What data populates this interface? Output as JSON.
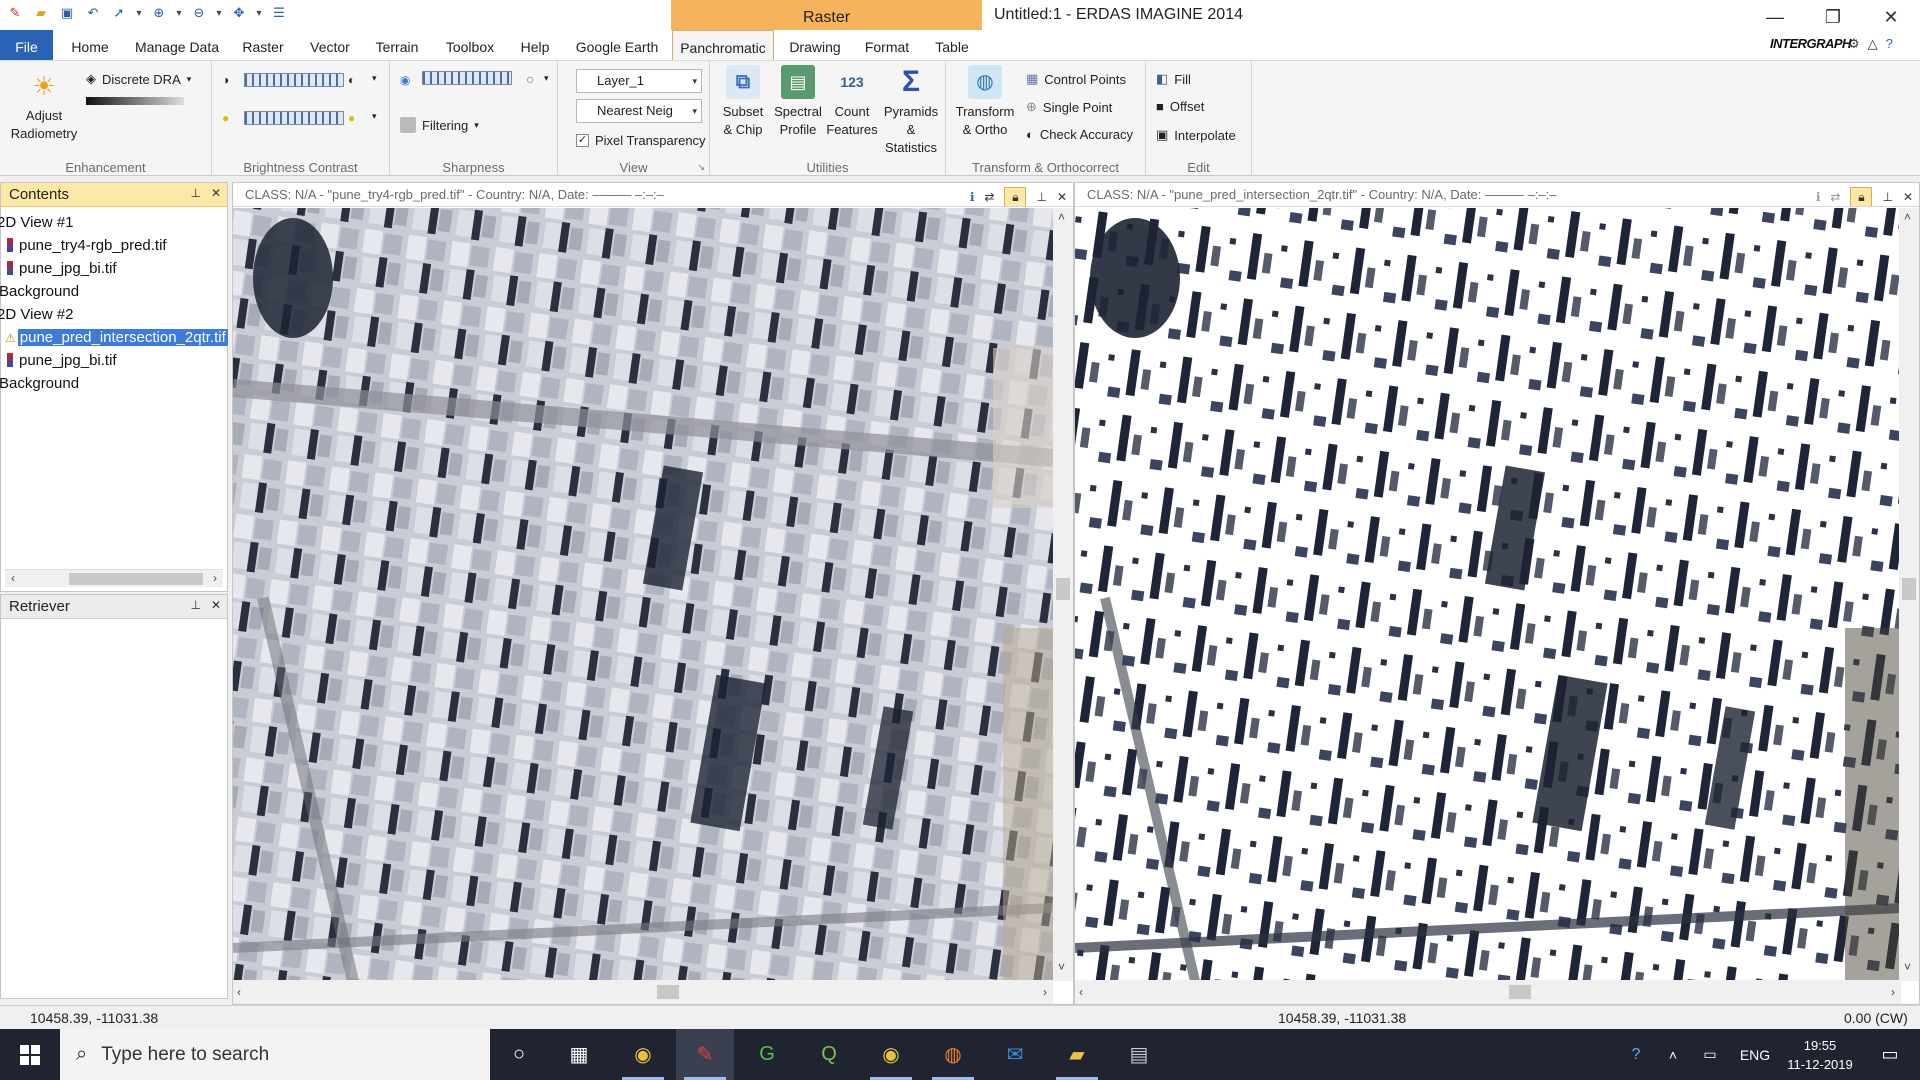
{
  "title_bar": {
    "window_title": "Untitled:1 - ERDAS IMAGINE 2014",
    "context_tab_group": "Raster",
    "controls": {
      "minimize": "—",
      "restore": "❐",
      "close": "✕"
    }
  },
  "ribbon_tabs": [
    "File",
    "Home",
    "Manage Data",
    "Raster",
    "Vector",
    "Terrain",
    "Toolbox",
    "Help",
    "Google Earth",
    "Panchromatic",
    "Drawing",
    "Format",
    "Table"
  ],
  "brand": "INTERGRAPH",
  "ribbon": {
    "enhancement": {
      "label": "Enhancement",
      "adjust_radiometry": "Adjust\nRadiometry",
      "discrete_dra": "Discrete DRA"
    },
    "brightness_contrast": {
      "label": "Brightness Contrast"
    },
    "sharpness": {
      "label": "Sharpness",
      "filtering": "Filtering"
    },
    "view": {
      "label": "View",
      "layer_combo": "Layer_1",
      "resample_combo": "Nearest Neig",
      "pixel_transparency": "Pixel Transparency"
    },
    "utilities": {
      "label": "Utilities",
      "subset_chip": "Subset\n& Chip",
      "spectral_profile": "Spectral\nProfile",
      "count_features": "Count\nFeatures",
      "pyramids_statistics": "Pyramids &\nStatistics"
    },
    "transform": {
      "label": "Transform & Orthocorrect",
      "transform_ortho": "Transform\n& Ortho",
      "control_points": "Control Points",
      "single_point": "Single Point",
      "check_accuracy": "Check Accuracy"
    },
    "edit": {
      "label": "Edit",
      "fill": "Fill",
      "offset": "Offset",
      "interpolate": "Interpolate"
    }
  },
  "contents_panel": {
    "title": "Contents",
    "items": [
      {
        "label": "2D View #1",
        "type": "view"
      },
      {
        "label": "pune_try4-rgb_pred.tif",
        "type": "layer"
      },
      {
        "label": "pune_jpg_bi.tif",
        "type": "layer"
      },
      {
        "label": "Background",
        "type": "bg"
      },
      {
        "label": "2D View #2",
        "type": "view"
      },
      {
        "label": "pune_pred_intersection_2qtr.tif",
        "type": "layer",
        "selected": true
      },
      {
        "label": "pune_jpg_bi.tif",
        "type": "layer"
      },
      {
        "label": "Background",
        "type": "bg"
      }
    ]
  },
  "retriever_panel": {
    "title": "Retriever"
  },
  "view1": {
    "header": "CLASS: N/A - \"pune_try4-rgb_pred.tif\" - Country: N/A, Date: ——— –:–:–"
  },
  "view2": {
    "header": "CLASS: N/A - \"pune_pred_intersection_2qtr.tif\" - Country: N/A, Date: ——— –:–:–"
  },
  "status_bar": {
    "coords_left": "10458.39, -11031.38",
    "coords_right": "10458.39, -11031.38",
    "rotation": "0.00 (CW)"
  },
  "taskbar": {
    "search_placeholder": "Type here to search",
    "language": "ENG",
    "time": "19:55",
    "date": "11-12-2019"
  },
  "colors": {
    "file_tab": "#2a63b6",
    "context_group": "#f7b35b",
    "active_panel_header": "#fde9a5",
    "selection": "#3d7bd9",
    "taskbar": "#1f2430"
  }
}
